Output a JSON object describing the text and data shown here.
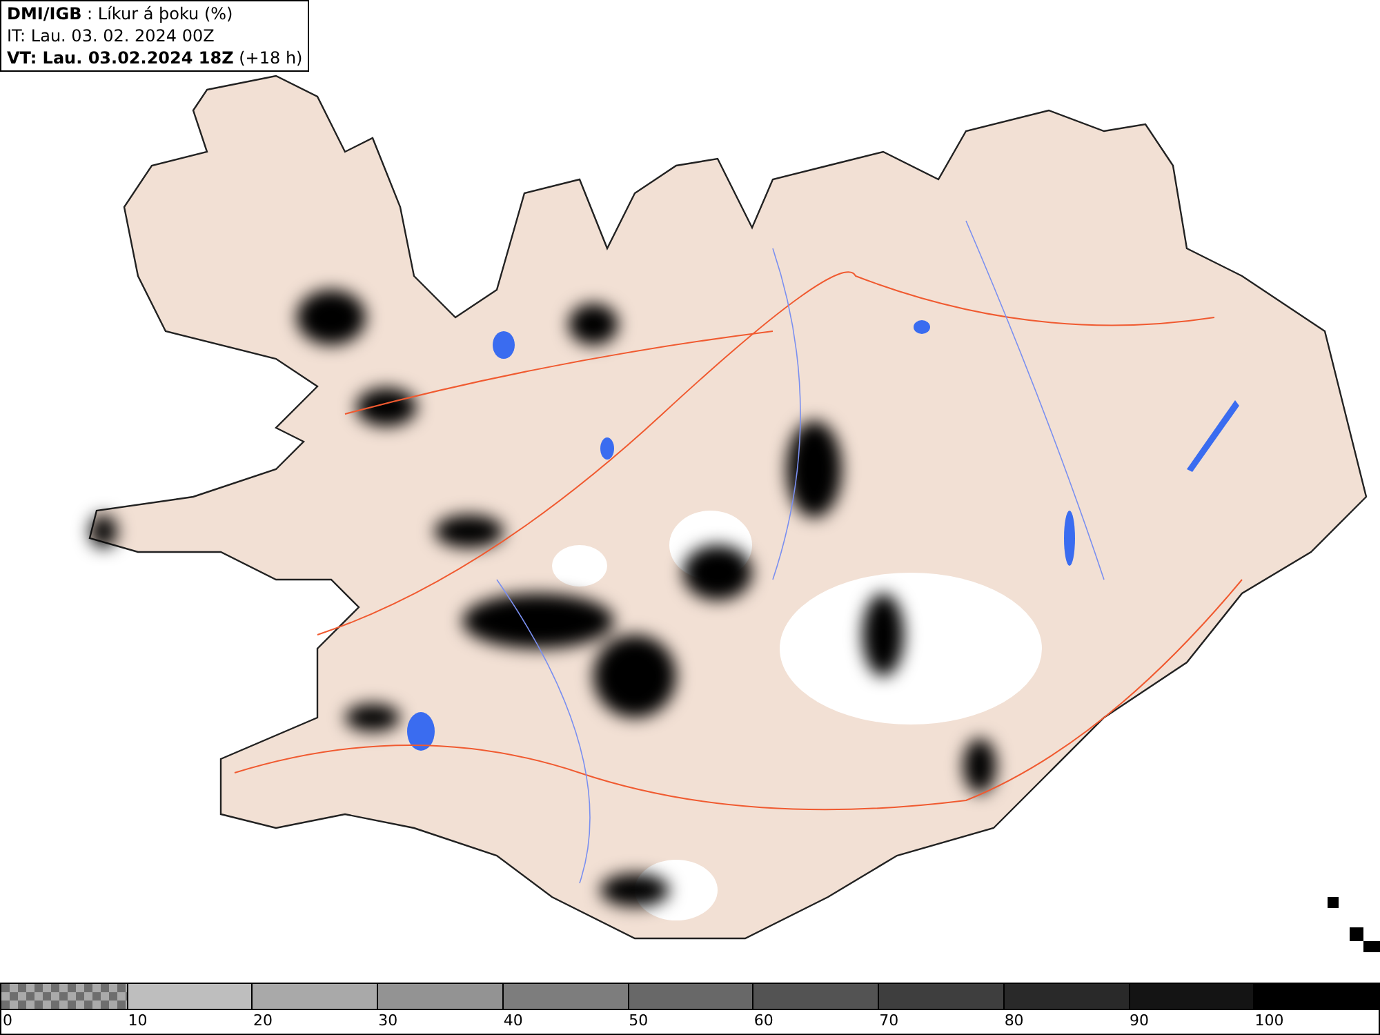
{
  "legend": {
    "lines": [
      "**DMI/IGB** : Líkur á þoku (%)",
      "IT: Lau. 03. 02. 2024 00Z",
      "**VT: Lau. 03.02.2024 18Z** (+18 h)"
    ]
  },
  "colorbar": {
    "segments": [
      {
        "kind": "checker",
        "color": "#6e6e6e"
      },
      {
        "kind": "solid",
        "color": "#bebebe"
      },
      {
        "kind": "solid",
        "color": "#a9a9a9"
      },
      {
        "kind": "solid",
        "color": "#939393"
      },
      {
        "kind": "solid",
        "color": "#7d7d7d"
      },
      {
        "kind": "solid",
        "color": "#686868"
      },
      {
        "kind": "solid",
        "color": "#535353"
      },
      {
        "kind": "solid",
        "color": "#3e3e3e"
      },
      {
        "kind": "solid",
        "color": "#292929"
      },
      {
        "kind": "solid",
        "color": "#141414"
      },
      {
        "kind": "solid",
        "color": "#000000"
      }
    ],
    "ticks": [
      "0",
      "10",
      "20",
      "30",
      "40",
      "50",
      "60",
      "70",
      "80",
      "90",
      "100"
    ]
  }
}
